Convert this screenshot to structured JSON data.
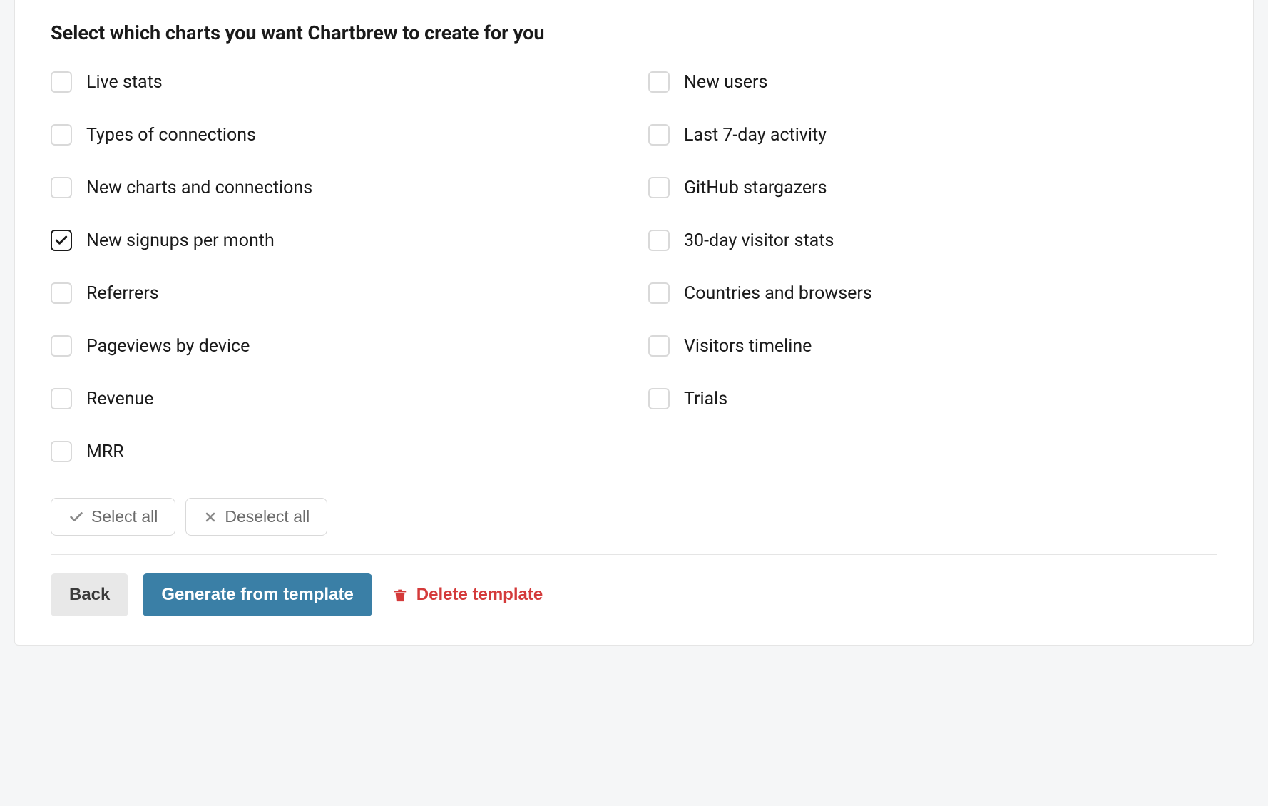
{
  "heading": "Select which charts you want Chartbrew to create for you",
  "left_options": [
    {
      "label": "Live stats",
      "checked": false
    },
    {
      "label": "Types of connections",
      "checked": false
    },
    {
      "label": "New charts and connections",
      "checked": false
    },
    {
      "label": "New signups per month",
      "checked": true
    },
    {
      "label": "Referrers",
      "checked": false
    },
    {
      "label": "Pageviews by device",
      "checked": false
    },
    {
      "label": "Revenue",
      "checked": false
    },
    {
      "label": "MRR",
      "checked": false
    }
  ],
  "right_options": [
    {
      "label": "New users",
      "checked": false
    },
    {
      "label": "Last 7-day activity",
      "checked": false
    },
    {
      "label": "GitHub stargazers",
      "checked": false
    },
    {
      "label": "30-day visitor stats",
      "checked": false
    },
    {
      "label": "Countries and browsers",
      "checked": false
    },
    {
      "label": "Visitors timeline",
      "checked": false
    },
    {
      "label": "Trials",
      "checked": false
    }
  ],
  "buttons": {
    "select_all": "Select all",
    "deselect_all": "Deselect all",
    "back": "Back",
    "generate": "Generate from template",
    "delete": "Delete template"
  }
}
